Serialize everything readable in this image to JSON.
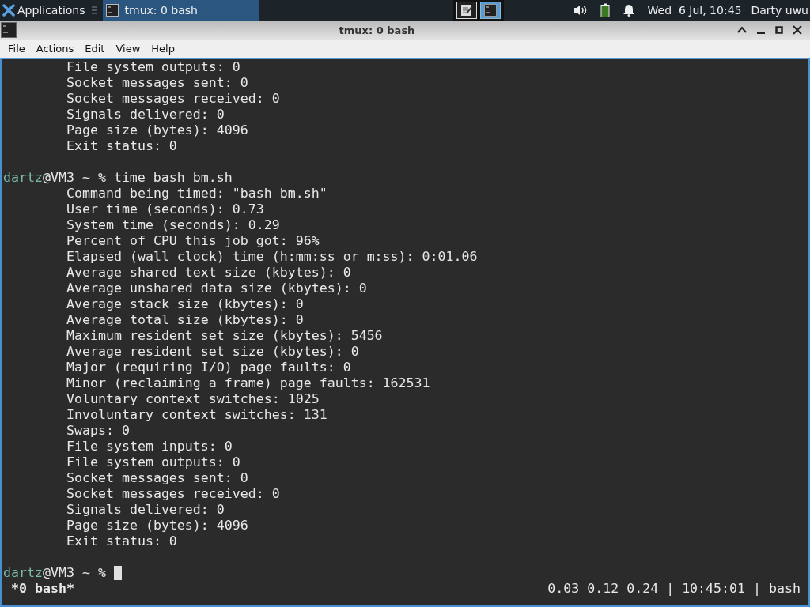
{
  "panel": {
    "apps_menu": "Applications",
    "tasks": [
      {
        "title": "tmux: 0 bash",
        "selected": true
      }
    ],
    "workspaces": [
      {
        "kind": "editor",
        "selected": false
      },
      {
        "kind": "terminal",
        "selected": true
      }
    ],
    "clock": "Wed  6 Jul, 10:45",
    "user": "Darty uwu"
  },
  "window": {
    "title": "tmux: 0 bash"
  },
  "menu": [
    "File",
    "Actions",
    "Edit",
    "View",
    "Help"
  ],
  "terminal": {
    "lines": [
      {
        "kind": "output",
        "text": "File system outputs: 0"
      },
      {
        "kind": "output",
        "text": "Socket messages sent: 0"
      },
      {
        "kind": "output",
        "text": "Socket messages received: 0"
      },
      {
        "kind": "output",
        "text": "Signals delivered: 0"
      },
      {
        "kind": "output",
        "text": "Page size (bytes): 4096"
      },
      {
        "kind": "output",
        "text": "Exit status: 0"
      },
      {
        "kind": "blank"
      },
      {
        "kind": "prompt",
        "user": "dartz",
        "host": "@VM3 ~ %",
        "command": "time bash bm.sh"
      },
      {
        "kind": "output",
        "text": "Command being timed: \"bash bm.sh\""
      },
      {
        "kind": "output",
        "text": "User time (seconds): 0.73"
      },
      {
        "kind": "output",
        "text": "System time (seconds): 0.29"
      },
      {
        "kind": "output",
        "text": "Percent of CPU this job got: 96%"
      },
      {
        "kind": "output",
        "text": "Elapsed (wall clock) time (h:mm:ss or m:ss): 0:01.06"
      },
      {
        "kind": "output",
        "text": "Average shared text size (kbytes): 0"
      },
      {
        "kind": "output",
        "text": "Average unshared data size (kbytes): 0"
      },
      {
        "kind": "output",
        "text": "Average stack size (kbytes): 0"
      },
      {
        "kind": "output",
        "text": "Average total size (kbytes): 0"
      },
      {
        "kind": "output",
        "text": "Maximum resident set size (kbytes): 5456"
      },
      {
        "kind": "output",
        "text": "Average resident set size (kbytes): 0"
      },
      {
        "kind": "output",
        "text": "Major (requiring I/O) page faults: 0"
      },
      {
        "kind": "output",
        "text": "Minor (reclaiming a frame) page faults: 162531"
      },
      {
        "kind": "output",
        "text": "Voluntary context switches: 1025"
      },
      {
        "kind": "output",
        "text": "Involuntary context switches: 131"
      },
      {
        "kind": "output",
        "text": "Swaps: 0"
      },
      {
        "kind": "output",
        "text": "File system inputs: 0"
      },
      {
        "kind": "output",
        "text": "File system outputs: 0"
      },
      {
        "kind": "output",
        "text": "Socket messages sent: 0"
      },
      {
        "kind": "output",
        "text": "Socket messages received: 0"
      },
      {
        "kind": "output",
        "text": "Signals delivered: 0"
      },
      {
        "kind": "output",
        "text": "Page size (bytes): 4096"
      },
      {
        "kind": "output",
        "text": "Exit status: 0"
      },
      {
        "kind": "blank"
      },
      {
        "kind": "prompt",
        "user": "dartz",
        "host": "@VM3 ~ %",
        "cursor": true
      }
    ],
    "status_left": "*0 bash*",
    "status_right": "0.03 0.12 0.24 | 10:45:01 | bash"
  }
}
